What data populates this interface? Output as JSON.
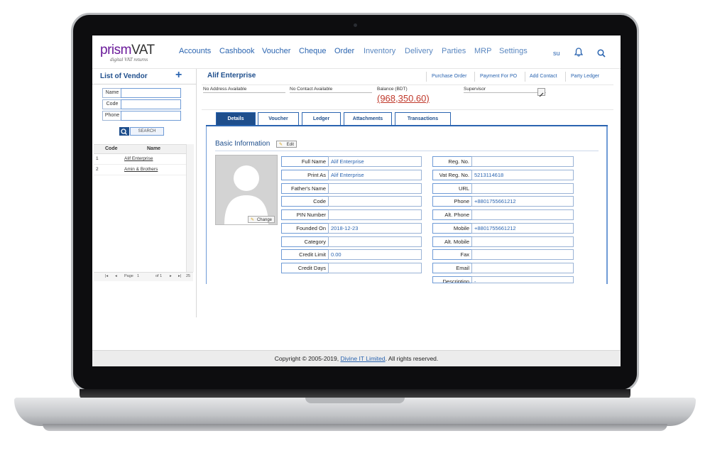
{
  "app": {
    "logo_prism": "prism",
    "logo_vat": "VAT",
    "logo_sub": "digital VAT returns",
    "menu": [
      "Accounts",
      "Cashbook",
      "Voucher",
      "Cheque",
      "Order",
      "Inventory",
      "Delivery",
      "Parties",
      "MRP",
      "Settings"
    ],
    "user": "su",
    "icons": {
      "bell": "bell-icon",
      "search": "search-icon",
      "plus": "plus-icon",
      "edit": "pencil-icon"
    },
    "colors": {
      "brand_blue": "#1e4e8c",
      "link_blue": "#2a64b0",
      "balance_red": "#c0392b",
      "logo_purple": "#6a1b9a"
    }
  },
  "vendor_list": {
    "title": "List of Vendor",
    "fields": [
      "Name",
      "Code",
      "Phone"
    ],
    "search_label": "SEARCH",
    "columns": [
      "Code",
      "Name"
    ],
    "rows": [
      {
        "num": "1",
        "name": "Alif Enterprise"
      },
      {
        "num": "2",
        "name": "Amin & Brothers"
      }
    ],
    "pager": {
      "page_label": "Page",
      "page": "1",
      "of": "of 1",
      "size": "25"
    }
  },
  "vendor": {
    "name": "Alif Enterprise",
    "actions": [
      "Purchase Order",
      "Payment For PO",
      "Add Contact",
      "Party Ledger"
    ],
    "address": "No Address Available",
    "contact": "No Contact Available",
    "balance_label": "Balance (BDT)",
    "balance": "(968,350.60)",
    "supervisor_label": "Supervisor"
  },
  "tabs": [
    "Details",
    "Voucher",
    "Ledger",
    "Attachments",
    "Transactions"
  ],
  "basic_info": {
    "title": "Basic Information",
    "edit_label": "Edit",
    "change_label": "Change",
    "left_fields": [
      {
        "label": "Full Name",
        "value": "Alif Enterprise"
      },
      {
        "label": "Print As",
        "value": "Alif Enterprise"
      },
      {
        "label": "Father's Name",
        "value": ""
      },
      {
        "label": "Code",
        "value": ""
      },
      {
        "label": "PIN Number",
        "value": ""
      },
      {
        "label": "Founded On",
        "value": "2018-12-23"
      },
      {
        "label": "Category",
        "value": ""
      },
      {
        "label": "Credit Limit",
        "value": "0.00"
      },
      {
        "label": "Credit Days",
        "value": ""
      }
    ],
    "right_fields": [
      {
        "label": "Reg. No.",
        "value": ""
      },
      {
        "label": "Vat Reg. No.",
        "value": "5213114618"
      },
      {
        "label": "URL",
        "value": ""
      },
      {
        "label": "Phone",
        "value": "+8801755661212"
      },
      {
        "label": "Alt. Phone",
        "value": ""
      },
      {
        "label": "Mobile",
        "value": "+8801755661212"
      },
      {
        "label": "Alt. Mobile",
        "value": ""
      },
      {
        "label": "Fax",
        "value": ""
      },
      {
        "label": "Email",
        "value": ""
      },
      {
        "label": "Description",
        "value": "-"
      }
    ]
  },
  "footer": {
    "prefix": "Copyright © 2005-2019, ",
    "link": "Divine IT Limited",
    "suffix": ". All rights reserved."
  }
}
